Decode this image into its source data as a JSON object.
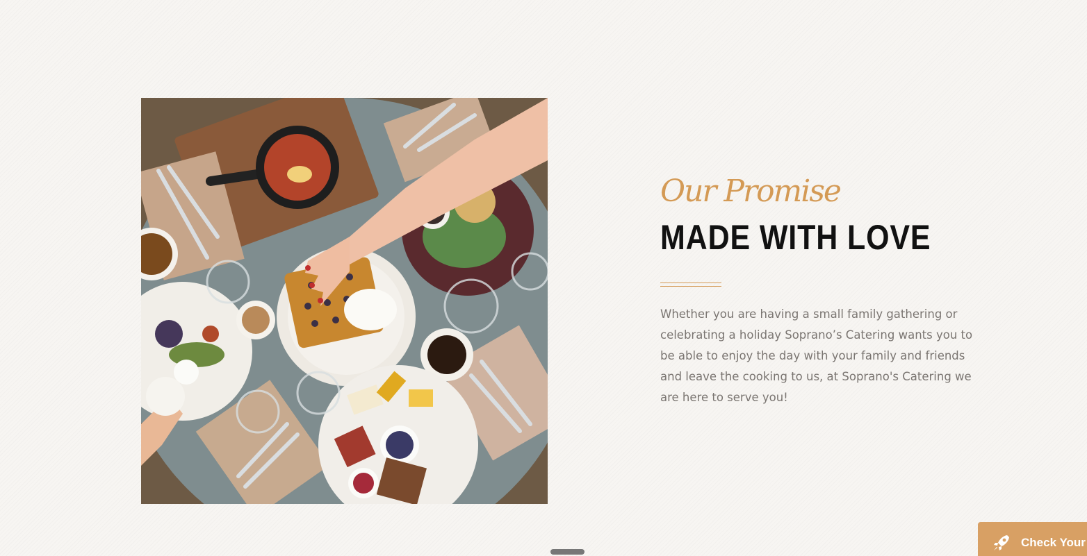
{
  "section": {
    "script_title": "Our Promise",
    "title": "MADE WITH LOVE",
    "description": "Whether you are having a small family gathering or celebrating a holiday Soprano’s Catering wants you to be able to enjoy the day with your family and friends and leave the cooking to us, at Soprano's Catering we are here to serve you!"
  },
  "photo": {
    "subject": "brunch-table-photo"
  },
  "cta": {
    "label": "Check Your",
    "icon": "rocket-icon"
  },
  "colors": {
    "accent": "#d49a55",
    "heading": "#111111",
    "body_text": "#7a7571",
    "cta_background": "#d8a064"
  }
}
